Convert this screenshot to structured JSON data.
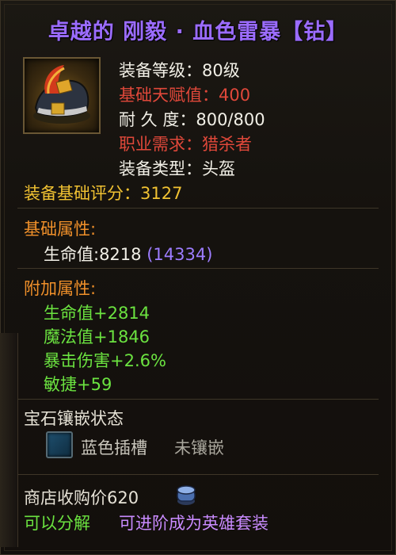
{
  "title": "卓越的 刚毅 · 血色雷暴【钻】",
  "icon": "helmet-icon",
  "stats": {
    "level": "装备等级：80级",
    "base_talent": "基础天赋值：400",
    "durability": "耐 久 度：800/800",
    "class_req": "职业需求：猎杀者",
    "equip_type": "装备类型：头盔",
    "score_label": "装备基础评分：",
    "score_value": "3127"
  },
  "base_attrs": {
    "header": "基础属性:",
    "hp_label": "生命值:8218",
    "hp_extra": "(14334)"
  },
  "extra_attrs": {
    "header": "附加属性:",
    "items": [
      "生命值+2814",
      "魔法值+1846",
      "暴击伤害+2.6%",
      "敏捷+59"
    ]
  },
  "gem": {
    "header": "宝石镶嵌状态",
    "slot_label": "蓝色插槽",
    "slot_status": "未镶嵌"
  },
  "footer": {
    "shop_price": "商店收购价620",
    "decompose": "可以分解",
    "upgrade": "可进阶成为英雄套装"
  },
  "colors": {
    "title": "#9b6cff",
    "gold": "#f1c232",
    "red": "#e0483a",
    "green": "#6be340",
    "purple": "#9d7dff",
    "orange": "#f0902a"
  }
}
